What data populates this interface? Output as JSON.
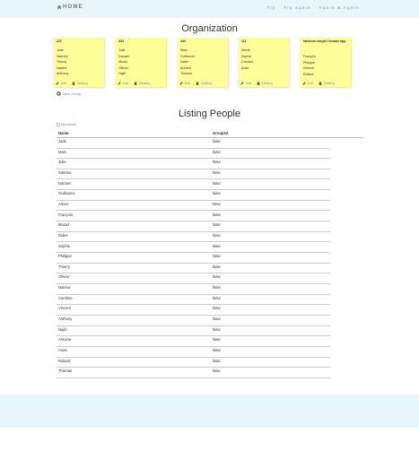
{
  "header": {
    "brand": "HOME",
    "links": [
      "Try",
      "Try again",
      "Again & Again"
    ]
  },
  "organization_title": "Organization",
  "groups": [
    {
      "title": "222",
      "members": [
        "Jade",
        "Sabrina",
        "Thierry",
        "Nabina",
        "Anthony"
      ],
      "edit": "Edit",
      "destroy": "Destroy"
    },
    {
      "title": "333",
      "members": [
        "Julie",
        "Damien",
        "Murad",
        "Ollivier",
        "Najib"
      ],
      "edit": "Edit",
      "destroy": "Destroy"
    },
    {
      "title": "444",
      "members": [
        "Marc",
        "Guillaume",
        "Didier",
        "Antoine",
        "Thomas"
      ],
      "edit": "Edit",
      "destroy": "Destroy"
    },
    {
      "title": "111",
      "members": [
        "Alexis",
        "Sophie",
        "Caroline",
        "Anas"
      ],
      "edit": "Edit",
      "destroy": "Destroy"
    },
    {
      "title": "tamboor amphi l'ocaais app",
      "members": [
        "François",
        "Philippe",
        "Vincent",
        "Roland"
      ],
      "edit": "Edit",
      "destroy": "Destroy"
    }
  ],
  "new_group": "New Group",
  "listing_title": "Listing People",
  "membres_link": "Membres",
  "table": {
    "columns": [
      "Name",
      "Grouped"
    ],
    "rows": [
      {
        "name": "Jade",
        "grouped": "false"
      },
      {
        "name": "Marc",
        "grouped": "false"
      },
      {
        "name": "Julie",
        "grouped": "false"
      },
      {
        "name": "Sabrina",
        "grouped": "false"
      },
      {
        "name": "Damien",
        "grouped": "false"
      },
      {
        "name": "Guillaume",
        "grouped": "false"
      },
      {
        "name": "Alexis",
        "grouped": "false"
      },
      {
        "name": "François",
        "grouped": "false"
      },
      {
        "name": "Murad",
        "grouped": "false"
      },
      {
        "name": "Didier",
        "grouped": "false"
      },
      {
        "name": "Sophie",
        "grouped": "false"
      },
      {
        "name": "Philippe",
        "grouped": "false"
      },
      {
        "name": "Thierry",
        "grouped": "false"
      },
      {
        "name": "Ollivier",
        "grouped": "false"
      },
      {
        "name": "Nabina",
        "grouped": "false"
      },
      {
        "name": "Caroline",
        "grouped": "false"
      },
      {
        "name": "Vincent",
        "grouped": "false"
      },
      {
        "name": "Anthony",
        "grouped": "false"
      },
      {
        "name": "Najib",
        "grouped": "false"
      },
      {
        "name": "Antoine",
        "grouped": "false"
      },
      {
        "name": "Anas",
        "grouped": "false"
      },
      {
        "name": "Roland",
        "grouped": "false"
      },
      {
        "name": "Thomas",
        "grouped": "false"
      }
    ]
  },
  "colors": {
    "header_bg": "#e6f6fb",
    "note_bg": "#ffff99",
    "link": "#5a8fc2"
  }
}
